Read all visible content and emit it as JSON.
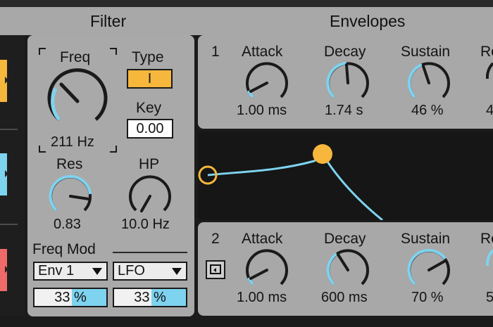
{
  "colors": {
    "accent_orange": "#f6b73c",
    "accent_blue": "#7ed3ef",
    "panel_gray": "#a9a9a9",
    "graph_bg": "#161616"
  },
  "headers": {
    "filter": "Filter",
    "envelopes": "Envelopes"
  },
  "filter": {
    "freq": {
      "label": "Freq",
      "value": "211 Hz"
    },
    "type": {
      "label": "Type",
      "value": "I"
    },
    "key": {
      "label": "Key",
      "value": "0.00"
    },
    "res": {
      "label": "Res",
      "value": "0.83"
    },
    "hp": {
      "label": "HP",
      "value": "10.0 Hz"
    },
    "freq_mod": {
      "label": "Freq Mod",
      "source1": "Env 1",
      "source2": "LFO",
      "amount1": "33 %",
      "amount2": "33 %",
      "amount1_fraction": 0.33,
      "amount2_fraction": 0.33
    }
  },
  "env1": {
    "number": "1",
    "attack": {
      "label": "Attack",
      "value": "1.00 ms"
    },
    "decay": {
      "label": "Decay",
      "value": "1.74 s"
    },
    "sustain": {
      "label": "Sustain",
      "value": "46 %"
    },
    "release": {
      "label": "Re",
      "value": "4"
    }
  },
  "env2": {
    "number": "2",
    "attack": {
      "label": "Attack",
      "value": "1.00 ms"
    },
    "decay": {
      "label": "Decay",
      "value": "600 ms"
    },
    "sustain": {
      "label": "Sustain",
      "value": "70 %"
    },
    "release": {
      "label": "Re",
      "value": "5"
    }
  },
  "icons": {
    "loop": "loop-icon",
    "chip_arrow": "chevron-right-icon"
  }
}
